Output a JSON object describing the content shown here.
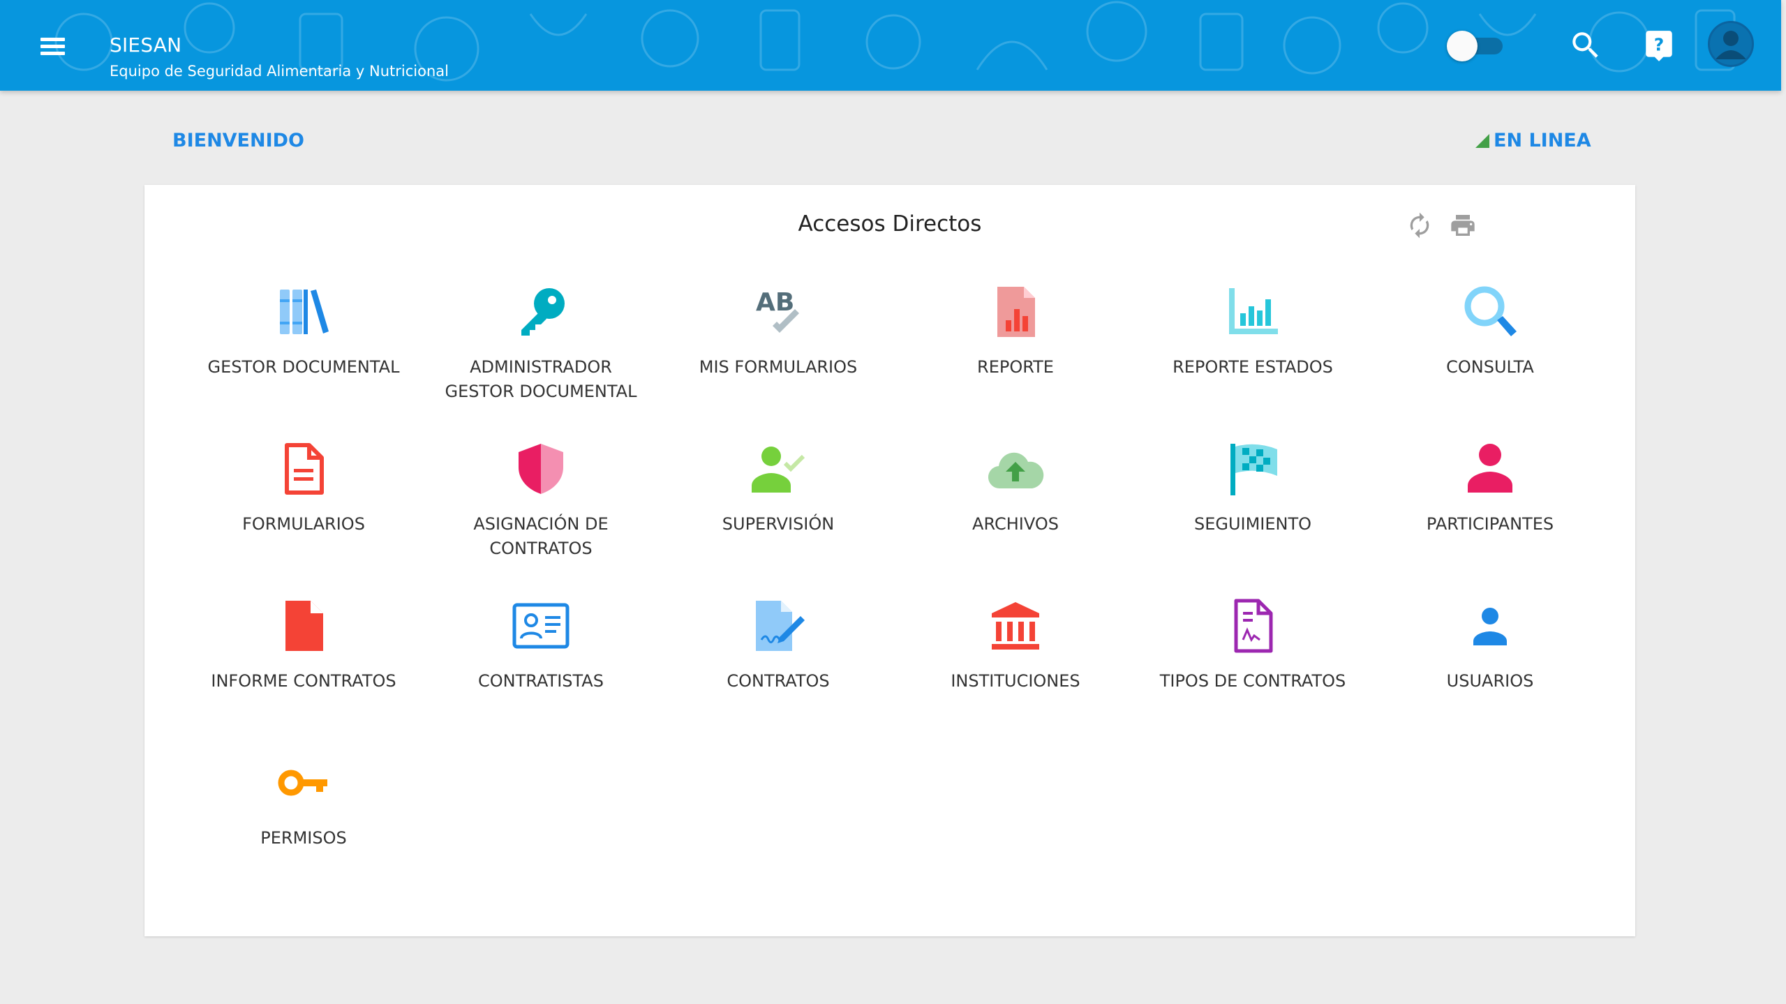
{
  "header": {
    "title": "SIESAN",
    "subtitle": "Equipo de Seguridad Alimentaria y Nutricional",
    "menu_icon": "menu-icon",
    "toggle_state": "off",
    "icons": [
      "search-icon",
      "help-icon",
      "account-icon"
    ]
  },
  "welcome": {
    "label": "BIENVENIDO"
  },
  "status": {
    "label": "EN LINEA",
    "icon": "signal-icon"
  },
  "panel": {
    "title": "Accesos Directos",
    "tools": [
      "refresh-icon",
      "print-icon"
    ]
  },
  "shortcuts": [
    {
      "label": "GESTOR DOCUMENTAL",
      "icon": "books-icon",
      "color": "#42a5f5"
    },
    {
      "label": "ADMINISTRADOR\nGESTOR DOCUMENTAL",
      "icon": "key-icon",
      "color": "#00acc1"
    },
    {
      "label": "MIS FORMULARIOS",
      "icon": "spellcheck-icon",
      "color": "#607d8b"
    },
    {
      "label": "REPORTE",
      "icon": "report-chart-icon",
      "color": "#f44336"
    },
    {
      "label": "REPORTE ESTADOS",
      "icon": "bar-chart-icon",
      "color": "#26c6da"
    },
    {
      "label": "CONSULTA",
      "icon": "magnifier-icon",
      "color": "#4fc3f7"
    },
    {
      "label": "FORMULARIOS",
      "icon": "document-icon",
      "color": "#f44336"
    },
    {
      "label": "ASIGNACIÓN DE\nCONTRATOS",
      "icon": "shield-icon",
      "color": "#e91e63"
    },
    {
      "label": "SUPERVISIÓN",
      "icon": "user-check-icon",
      "color": "#76d03c"
    },
    {
      "label": "ARCHIVOS",
      "icon": "cloud-upload-icon",
      "color": "#66bb6a"
    },
    {
      "label": "SEGUIMIENTO",
      "icon": "flag-icon",
      "color": "#26c6da"
    },
    {
      "label": "PARTICIPANTES",
      "icon": "person-icon",
      "color": "#e91e63"
    },
    {
      "label": "INFORME CONTRATOS",
      "icon": "file-icon",
      "color": "#f44336"
    },
    {
      "label": "CONTRATISTAS",
      "icon": "id-card-icon",
      "color": "#1e88e5"
    },
    {
      "label": "CONTRATOS",
      "icon": "contract-sign-icon",
      "color": "#42a5f5"
    },
    {
      "label": "INSTITUCIONES",
      "icon": "bank-icon",
      "color": "#f44336"
    },
    {
      "label": "TIPOS DE CONTRATOS",
      "icon": "signed-doc-icon",
      "color": "#9c27b0"
    },
    {
      "label": "USUARIOS",
      "icon": "user-icon",
      "color": "#1e88e5"
    },
    {
      "label": "PERMISOS",
      "icon": "vpn-key-icon",
      "color": "#ff9800"
    }
  ]
}
